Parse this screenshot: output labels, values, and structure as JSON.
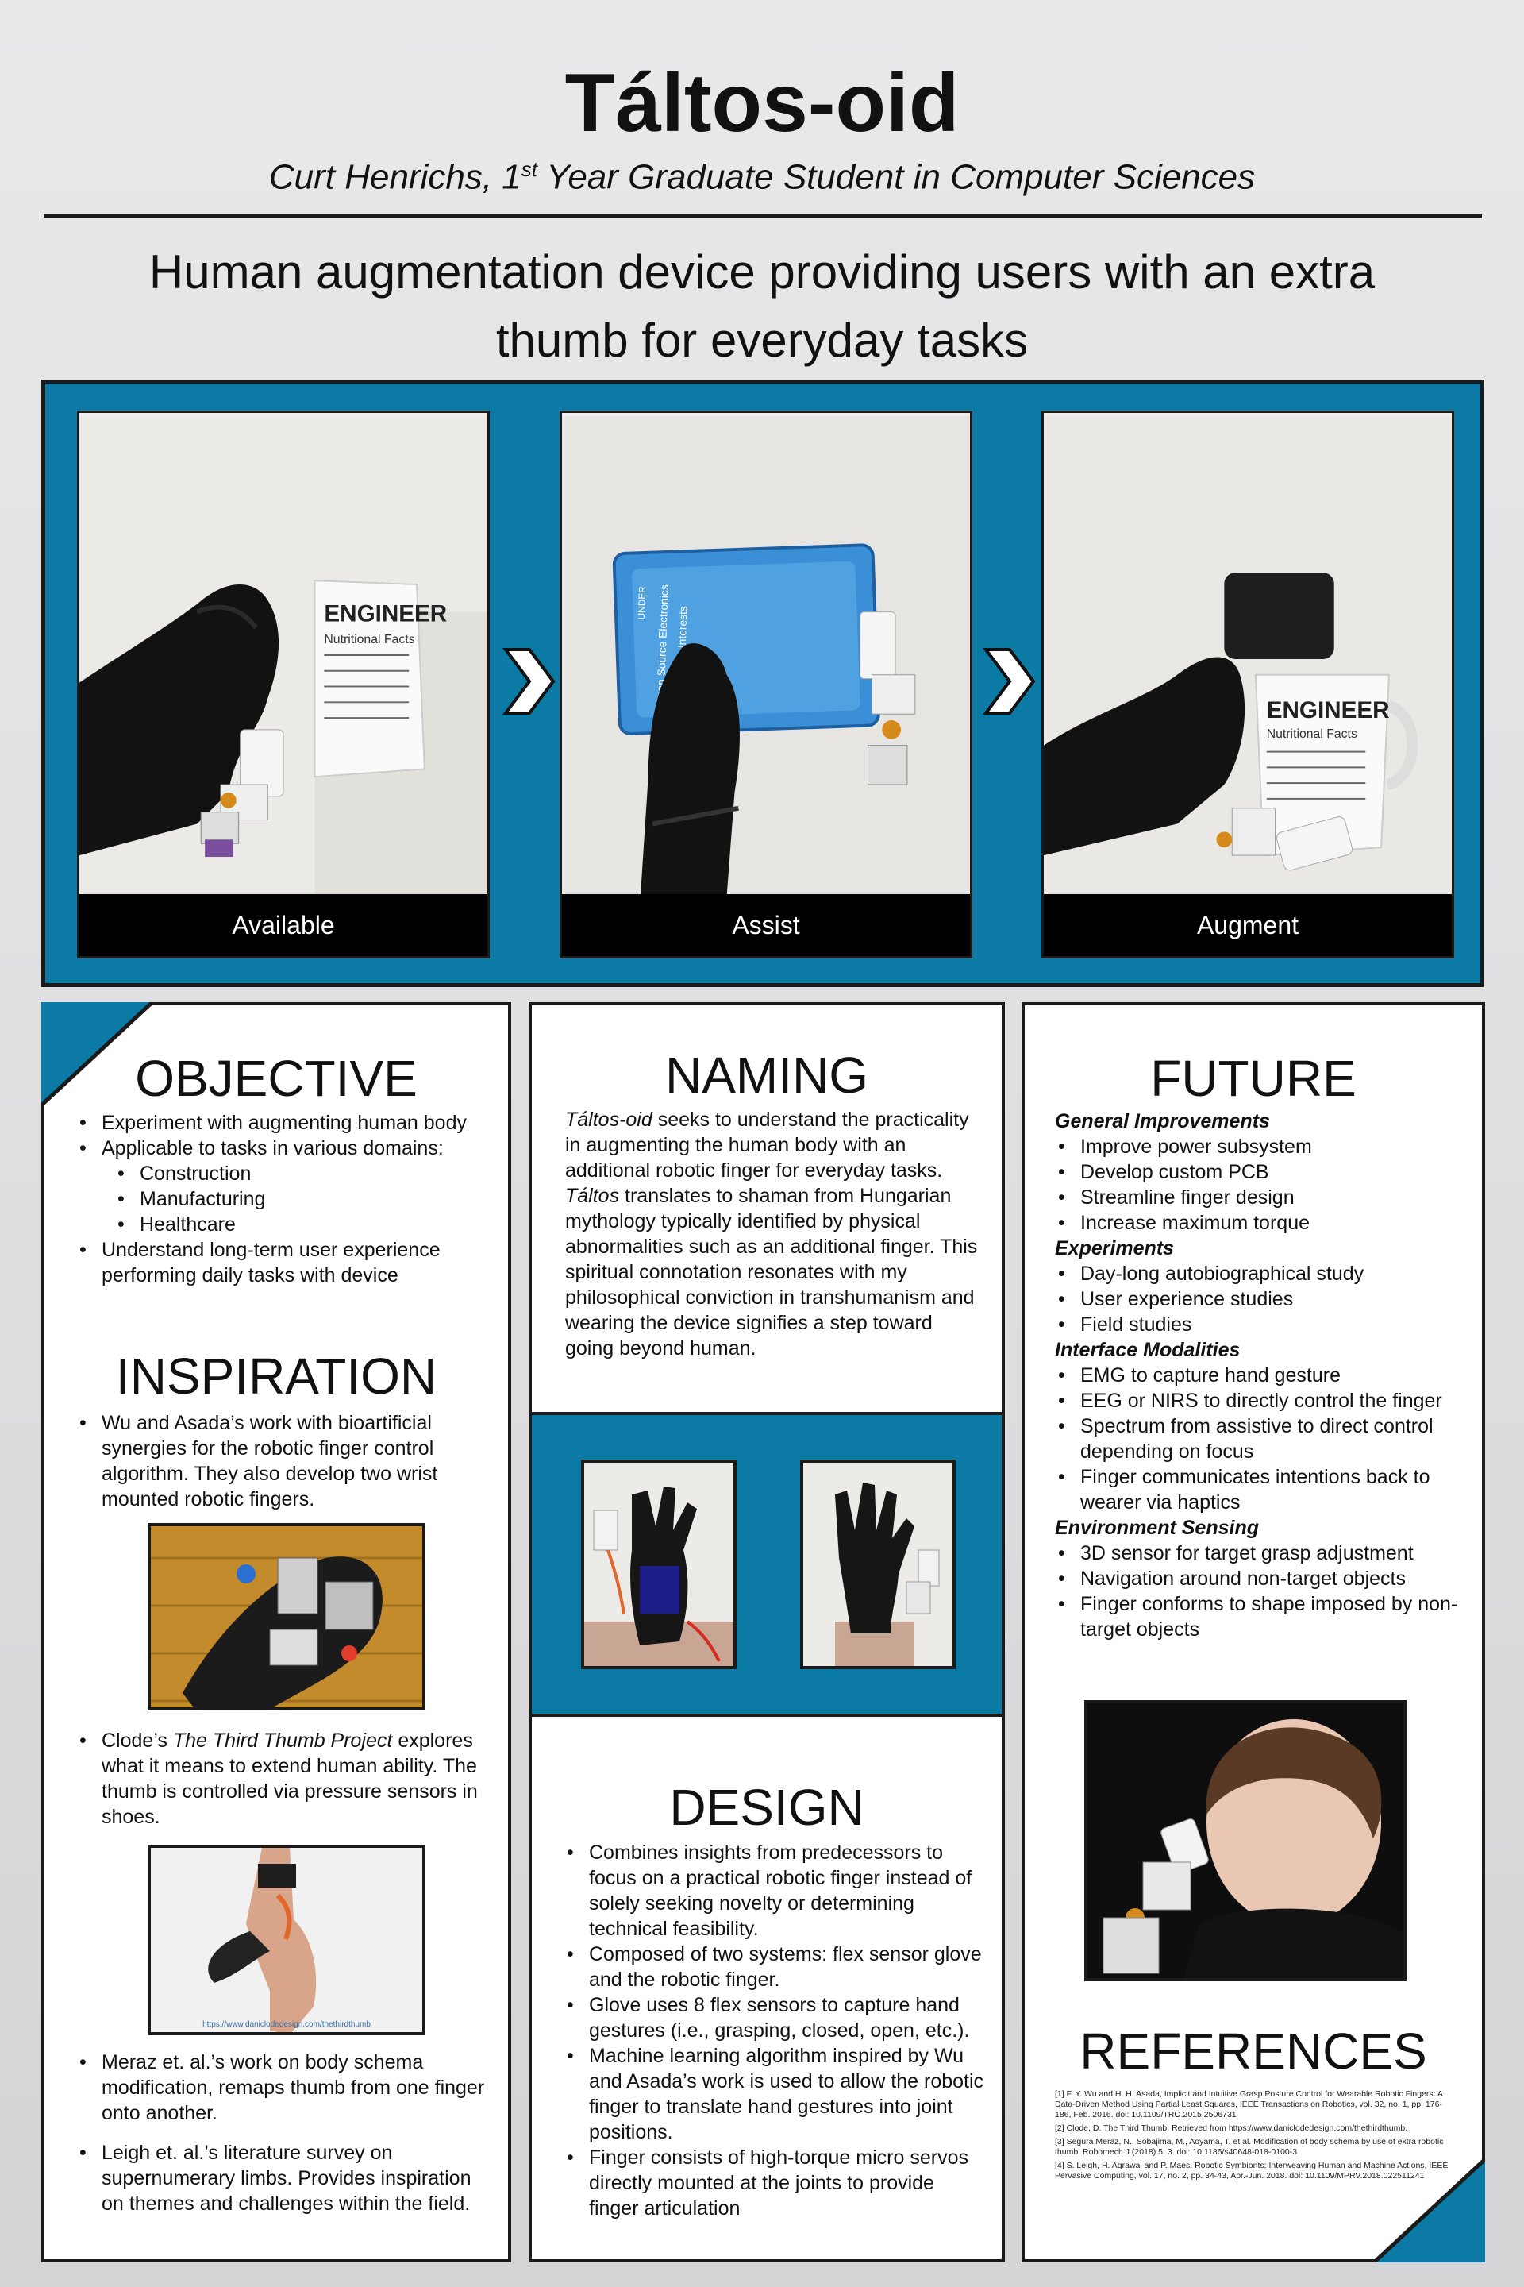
{
  "header": {
    "title": "Táltos-oid",
    "author_prefix": "Curt Henrichs, 1",
    "author_sup": "st",
    "author_suffix": " Year Graduate Student in Computer Sciences",
    "subtitle_line1": "Human augmentation device providing users with an extra",
    "subtitle_line2": "thumb for everyday tasks"
  },
  "banner": {
    "captions": [
      "Available",
      "Assist",
      "Augment"
    ],
    "mug_text": "ENGINEER",
    "mug_sub": "Nutritional Facts",
    "box_text1": "Open Source Electronics",
    "box_text2": "Developing Interests",
    "box_brand": "UNDER"
  },
  "objective": {
    "heading": "OBJECTIVE",
    "items": [
      "Experiment with augmenting human body",
      "Applicable to tasks in various domains:"
    ],
    "subitems": [
      "Construction",
      "Manufacturing",
      "Healthcare"
    ],
    "last": "Understand long-term user experience performing daily tasks with device"
  },
  "inspiration": {
    "heading": "INSPIRATION",
    "item1": "Wu and Asada’s work with bioartificial synergies for the robotic finger control algorithm. They also develop two wrist mounted robotic fingers.",
    "item2_pre": "Clode’s ",
    "item2_em": "The Third Thumb Project",
    "item2_post": " explores what it means to extend human ability. The thumb is controlled via pressure sensors in shoes.",
    "fig2_url": "https://www.daniclodedesign.com/thethirdthumb",
    "item3": "Meraz et. al.’s work on body schema modification, remaps thumb from one finger onto another.",
    "item4": "Leigh et. al.’s literature survey on supernumerary limbs. Provides inspiration on themes and challenges within the field."
  },
  "naming": {
    "heading": "NAMING",
    "em1": "Táltos-oid",
    "text1": " seeks to understand the practicality in augmenting the human body with an additional robotic finger for everyday tasks. ",
    "em2": "Táltos",
    "text2": " translates to shaman from Hungarian mythology typically identified by physical abnormalities such as an additional finger. This spiritual connotation resonates with my philosophical conviction in transhumanism and wearing the device signifies a step toward going beyond human."
  },
  "design": {
    "heading": "DESIGN",
    "items": [
      "Combines insights from predecessors to focus on a practical robotic finger instead of solely seeking novelty or determining technical feasibility.",
      "Composed of two systems: flex sensor glove and the robotic finger.",
      "Glove uses 8 flex sensors to capture hand gestures (i.e., grasping, closed, open, etc.).",
      "Machine learning algorithm inspired by Wu and Asada’s work is used to allow the robotic finger to translate hand gestures into joint positions.",
      "Finger consists of high-torque micro servos directly mounted at the joints to provide finger articulation"
    ]
  },
  "future": {
    "heading": "FUTURE",
    "groups": [
      {
        "title": "General Improvements",
        "items": [
          "Improve power subsystem",
          "Develop custom PCB",
          "Streamline finger design",
          "Increase maximum torque"
        ]
      },
      {
        "title": "Experiments",
        "items": [
          "Day-long autobiographical study",
          "User experience studies",
          "Field studies"
        ]
      },
      {
        "title": "Interface Modalities",
        "items": [
          "EMG to capture hand gesture",
          "EEG or NIRS to directly control the finger",
          "Spectrum from assistive to direct control depending on focus",
          "Finger communicates intentions back to wearer via haptics"
        ]
      },
      {
        "title": "Environment Sensing",
        "items": [
          "3D sensor for target grasp adjustment",
          "Navigation around non-target objects",
          "Finger conforms to shape imposed by non-target objects"
        ]
      }
    ]
  },
  "references": {
    "heading": "REFERENCES",
    "items": [
      "[1] F. Y. Wu and H. H. Asada, Implicit and Intuitive Grasp Posture Control for Wearable Robotic Fingers: A Data-Driven Method Using Partial Least Squares, IEEE Transactions on Robotics, vol. 32, no. 1, pp. 176-186, Feb. 2016. doi: 10.1109/TRO.2015.2506731",
      "[2] Clode, D. The Third Thumb. Retrieved from https://www.daniclodedesign.com/thethirdthumb.",
      "[3] Segura Meraz, N., Sobajima, M., Aoyama, T. et al. Modification of body schema by use of extra robotic thumb, Robomech J (2018) 5: 3. doi: 10.1186/s40648-018-0100-3",
      "[4] S. Leigh, H. Agrawal and P. Maes, Robotic Symbionts: Interweaving Human and Machine Actions, IEEE Pervasive Computing, vol. 17, no. 2, pp. 34-43, Apr.-Jun. 2018. doi: 10.1109/MPRV.2018.022511241"
    ]
  },
  "colors": {
    "accent": "#0b7aa4",
    "panel_border": "#1a1a1a",
    "caption_bg": "#000000"
  }
}
